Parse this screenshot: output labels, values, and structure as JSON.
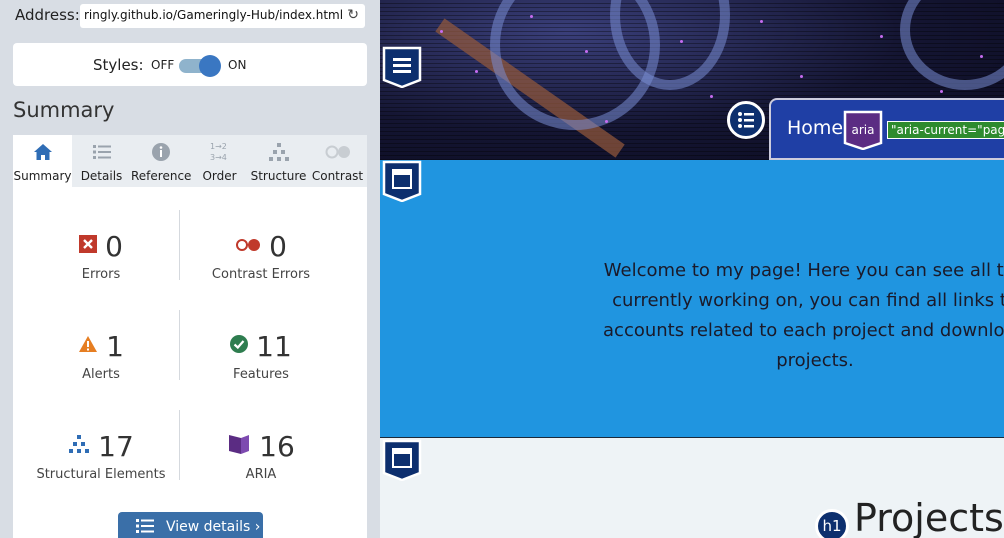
{
  "panel": {
    "address_label": "Address:",
    "address_value": "ringly.github.io/Gameringly-Hub/index.html",
    "styles_label": "Styles:",
    "styles_off": "OFF",
    "styles_on": "ON",
    "styles_enabled": true,
    "summary_title": "Summary",
    "tabs": [
      {
        "label": "Summary",
        "icon": "home-icon",
        "active": true
      },
      {
        "label": "Details",
        "icon": "list-icon",
        "active": false
      },
      {
        "label": "Reference",
        "icon": "info-icon",
        "active": false
      },
      {
        "label": "Order",
        "icon": "order-icon",
        "active": false
      },
      {
        "label": "Structure",
        "icon": "structure-icon",
        "active": false
      },
      {
        "label": "Contrast",
        "icon": "contrast-icon",
        "active": false
      }
    ],
    "stats": {
      "errors": {
        "value": "0",
        "label": "Errors",
        "icon": "error-icon",
        "color": "#c0392b"
      },
      "contrast_errors": {
        "value": "0",
        "label": "Contrast Errors",
        "icon": "contrast-error-icon",
        "color": "#c0392b"
      },
      "alerts": {
        "value": "1",
        "label": "Alerts",
        "icon": "alert-icon",
        "color": "#e67e22"
      },
      "features": {
        "value": "11",
        "label": "Features",
        "icon": "check-icon",
        "color": "#2e7d4f"
      },
      "structural": {
        "value": "17",
        "label": "Structural Elements",
        "icon": "structure-icon",
        "color": "#2f6db5"
      },
      "aria": {
        "value": "16",
        "label": "ARIA",
        "icon": "aria-icon",
        "color": "#5b2c83"
      }
    },
    "view_details_label": "View details ›"
  },
  "page": {
    "nav_home": "Home",
    "aria_badge": "aria",
    "aria_code": "\"aria-current=\"page",
    "welcome_lines": [
      "Welcome to my page! Here you can see all the",
      "currently working on, you can find all links to",
      "accounts related to each project and download",
      "projects."
    ],
    "h1_badge": "h1",
    "projects_heading": "Projects"
  },
  "colors": {
    "accent": "#3a6fa8",
    "page_blue": "#2095e0",
    "nav_blue": "#1f3fa5",
    "aria_green": "#2e8b2e"
  }
}
